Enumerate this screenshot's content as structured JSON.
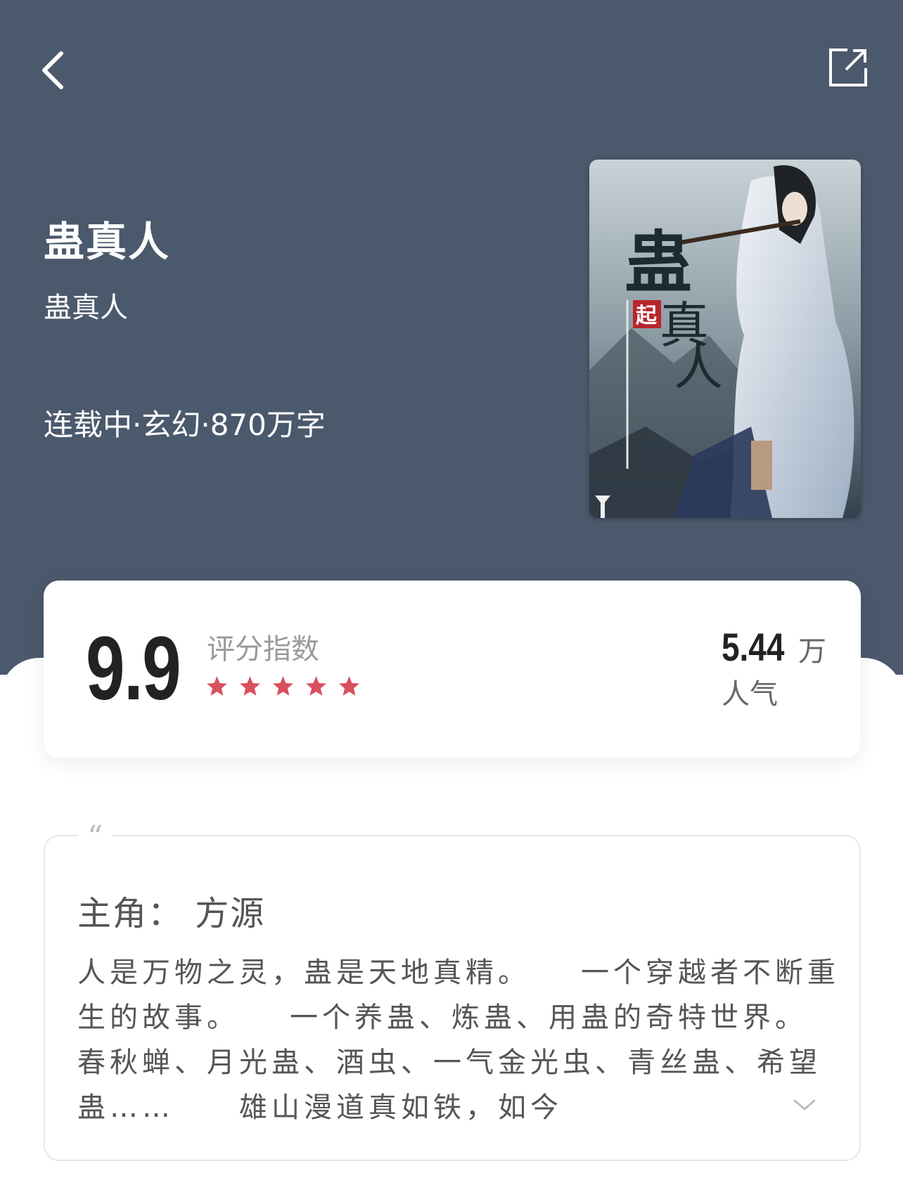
{
  "header": {
    "back_icon": "chevron-left-icon",
    "share_icon": "share-external-icon"
  },
  "book": {
    "title": "蛊真人",
    "author": "蛊真人",
    "meta": "连载中·玄幻·870万字",
    "cover_title_chars": "蛊真人",
    "cover_badge": "起"
  },
  "rating": {
    "score": "9.9",
    "label": "评分指数",
    "stars": 5,
    "star_color": "#d9505e"
  },
  "popularity": {
    "value": "5.44",
    "unit": "万",
    "label": "人气"
  },
  "intro": {
    "quote_mark": "“",
    "protagonist": "主角： 方源",
    "description": "人是万物之灵，蛊是天地真精。　　一个穿越者不断重生的故事。　　一个养蛊、炼蛊、用蛊的奇特世界。　　春秋蝉、月光蛊、酒虫、一气金光虫、青丝蛊、希望蛊……　　雄山漫道真如铁，如今",
    "expand_icon": "chevron-down-icon"
  },
  "colors": {
    "header_bg": "#4b596c",
    "text_dark": "#222222",
    "text_gray": "#9a9a9a"
  }
}
